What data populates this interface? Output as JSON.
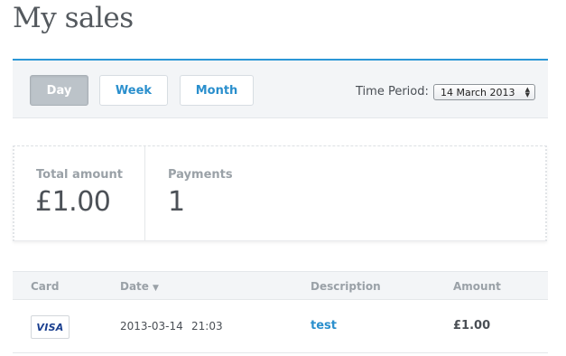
{
  "page": {
    "title": "My sales"
  },
  "toolbar": {
    "buttons": [
      {
        "label": "Day",
        "active": true
      },
      {
        "label": "Week",
        "active": false
      },
      {
        "label": "Month",
        "active": false
      }
    ],
    "time_period_label": "Time Period:",
    "time_period_value": "14 March 2013"
  },
  "summary": {
    "total_label": "Total amount",
    "total_value": "£1.00",
    "payments_label": "Payments",
    "payments_value": "1"
  },
  "table": {
    "columns": [
      "Card",
      "Date",
      "Description",
      "Amount"
    ],
    "date_sort": "descending",
    "rows": [
      {
        "card": "VISA",
        "date": "2013-03-14",
        "time": "21:03",
        "description": "test",
        "amount": "£1.00"
      }
    ]
  },
  "colors": {
    "accent": "#2b97d6",
    "link": "#2a8fcd",
    "active_button": "#bcc3c9"
  }
}
